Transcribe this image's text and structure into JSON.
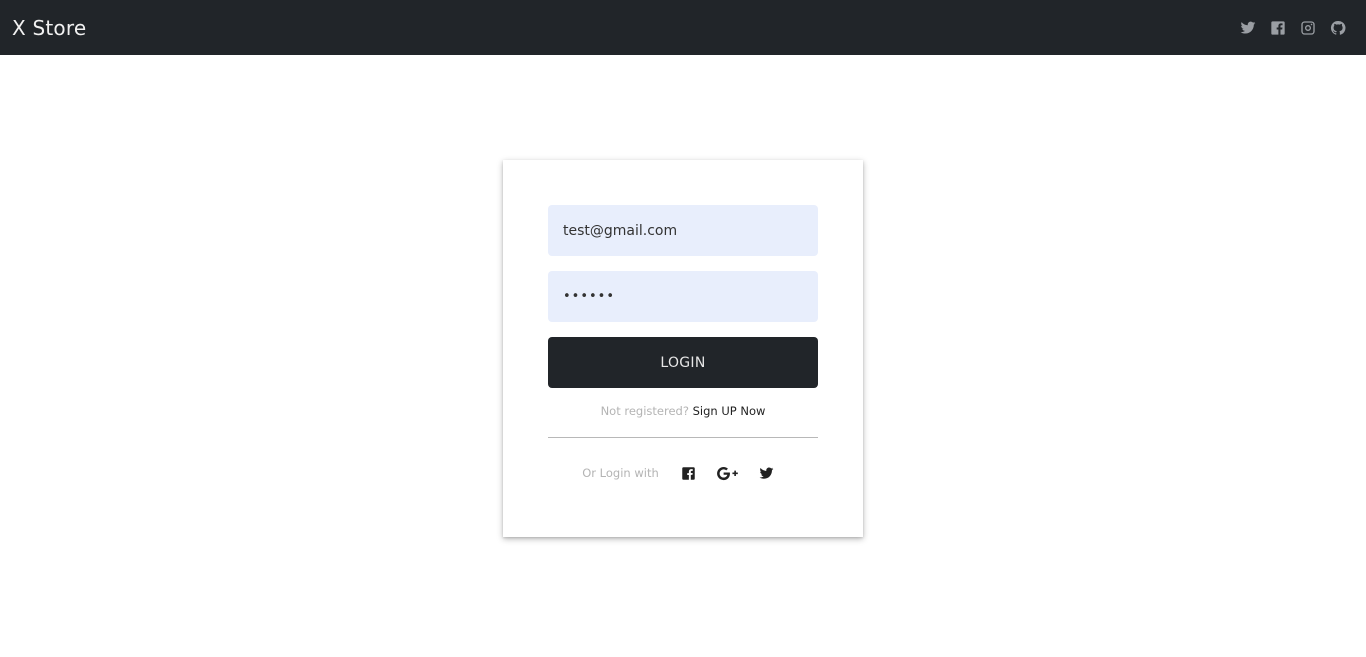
{
  "navbar": {
    "brand": "X Store",
    "social_icons": [
      "twitter-icon",
      "facebook-square-icon",
      "instagram-icon",
      "github-icon"
    ],
    "icon_color": "#9a9ea3",
    "background": "#212529"
  },
  "login_form": {
    "email_value": "test@gmail.com",
    "password_value": "••••••",
    "login_button": "LOGIN",
    "not_registered_text": "Not registered?",
    "signup_link": "Sign UP Now",
    "or_login_with": "Or Login with",
    "alt_login_icons": [
      "facebook-square-icon",
      "google-plus-icon",
      "twitter-icon"
    ],
    "input_background": "#e8eefc",
    "button_background": "#212529"
  }
}
